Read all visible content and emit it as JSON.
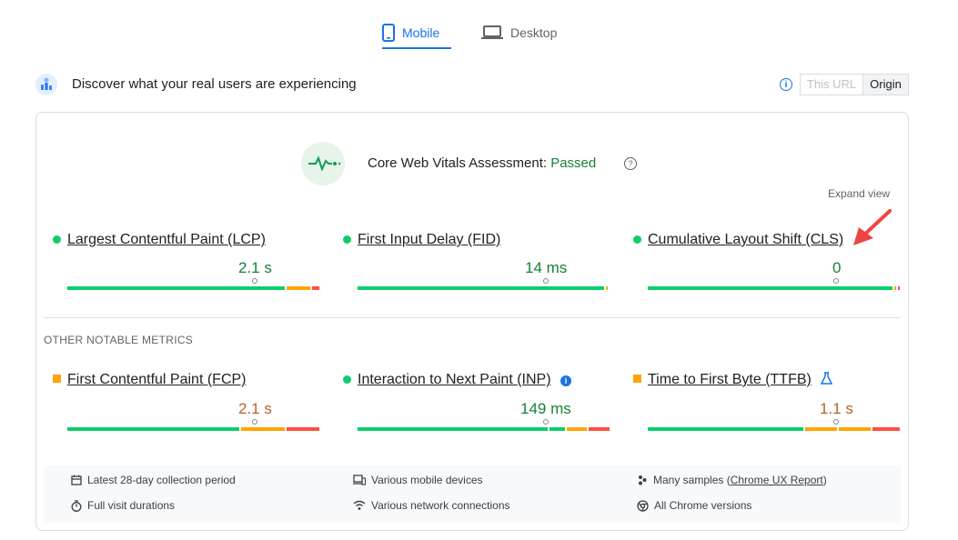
{
  "tabs": [
    {
      "label": "Mobile",
      "active": true
    },
    {
      "label": "Desktop",
      "active": false
    }
  ],
  "header": {
    "title": "Discover what your real users are experiencing",
    "scope_options": [
      "This URL",
      "Origin"
    ],
    "scope_selected": "Origin"
  },
  "assessment": {
    "label": "Core Web Vitals Assessment:",
    "status": "Passed",
    "expand_label": "Expand view"
  },
  "core_metrics": [
    {
      "name": "Largest Contentful Paint (LCP)",
      "value": "2.1 s",
      "rating": "good"
    },
    {
      "name": "First Input Delay (FID)",
      "value": "14 ms",
      "rating": "good"
    },
    {
      "name": "Cumulative Layout Shift (CLS)",
      "value": "0",
      "rating": "good"
    }
  ],
  "other_label": "OTHER NOTABLE METRICS",
  "other_metrics": [
    {
      "name": "First Contentful Paint (FCP)",
      "value": "2.1 s",
      "rating": "average"
    },
    {
      "name": "Interaction to Next Paint (INP)",
      "value": "149 ms",
      "rating": "good"
    },
    {
      "name": "Time to First Byte (TTFB)",
      "value": "1.1 s",
      "rating": "average"
    }
  ],
  "footer": {
    "period": "Latest 28-day collection period",
    "devices": "Various mobile devices",
    "samples_prefix": "Many samples (",
    "samples_link": "Chrome UX Report",
    "samples_suffix": ")",
    "durations": "Full visit durations",
    "network": "Various network connections",
    "versions": "All Chrome versions"
  },
  "colors": {
    "accent": "#1a73e8",
    "good": "#0cce6b",
    "average": "#ffa400",
    "poor": "#ff4e42",
    "good_text": "#188038",
    "average_text": "#b7612b",
    "annotation_arrow": "#ef4444"
  }
}
